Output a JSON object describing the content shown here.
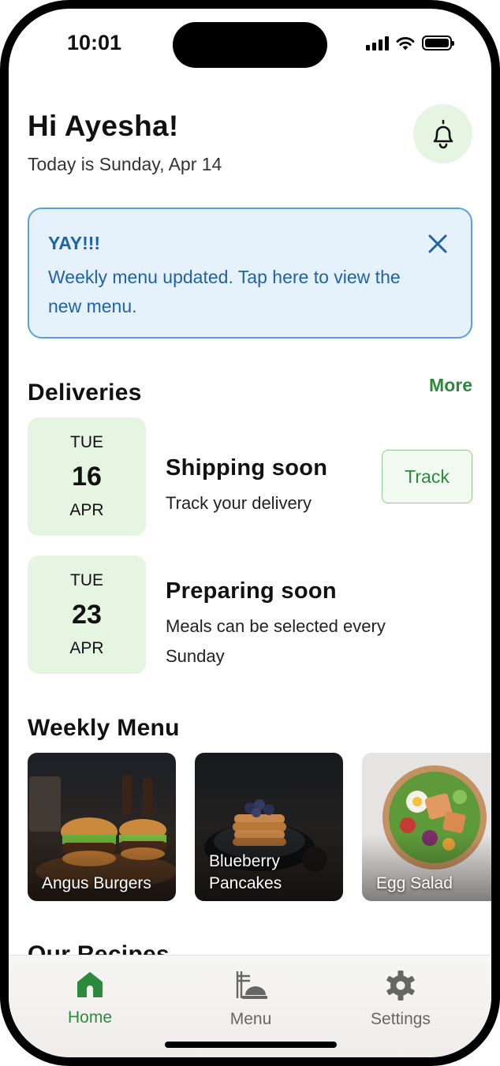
{
  "status_bar": {
    "time": "10:01"
  },
  "header": {
    "greeting": "Hi Ayesha!",
    "date_line": "Today is Sunday, Apr 14"
  },
  "alert": {
    "title": "YAY!!!",
    "message": "Weekly menu updated. Tap here to view the new menu."
  },
  "deliveries": {
    "title": "Deliveries",
    "more_label": "More",
    "items": [
      {
        "dow": "TUE",
        "day": "16",
        "month": "APR",
        "title": "Shipping soon",
        "subtitle": "Track your delivery",
        "action_label": "Track"
      },
      {
        "dow": "TUE",
        "day": "23",
        "month": "APR",
        "title": "Preparing soon",
        "subtitle": "Meals can be selected every Sunday"
      }
    ]
  },
  "weekly_menu": {
    "title": "Weekly Menu",
    "items": [
      {
        "name": "Angus Burgers",
        "image": "burger-photo"
      },
      {
        "name": "Blueberry Pancakes",
        "image": "pancakes-photo"
      },
      {
        "name": "Egg Salad",
        "image": "salad-photo"
      }
    ]
  },
  "recipes": {
    "title": "Our Recipes"
  },
  "tabbar": {
    "active_color": "#2c8a3e",
    "inactive_color": "#666666",
    "tabs": [
      {
        "label": "Home",
        "icon": "home-icon",
        "active": true
      },
      {
        "label": "Menu",
        "icon": "menu-icon",
        "active": false
      },
      {
        "label": "Settings",
        "icon": "gear-icon",
        "active": false
      }
    ]
  },
  "colors": {
    "accent_green": "#2c8a3e",
    "alert_blue": "#1f62a8",
    "alert_bg": "#e5f1fb",
    "date_box_bg": "#e6f4e2"
  }
}
